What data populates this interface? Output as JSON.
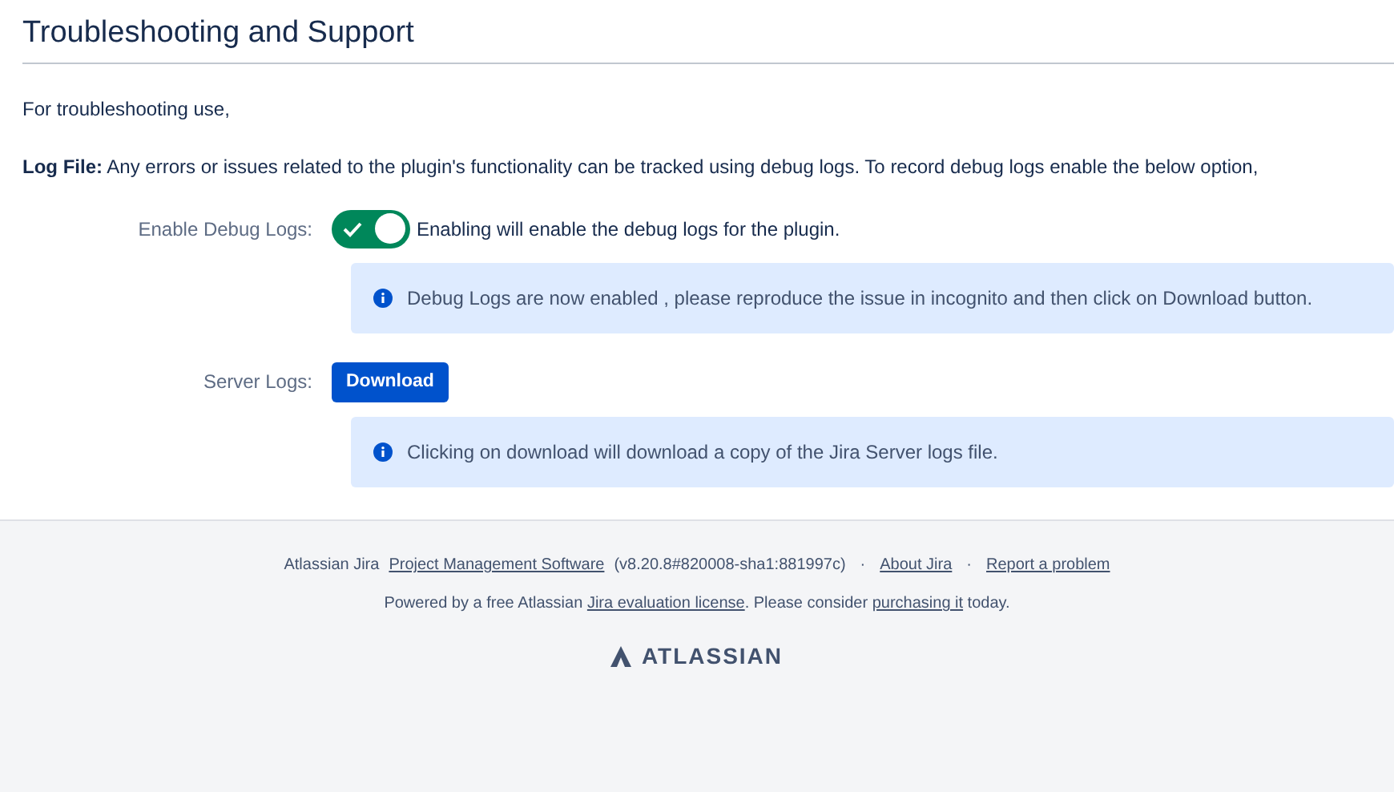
{
  "page": {
    "title": "Troubleshooting and Support"
  },
  "intro": "For troubleshooting use,",
  "log_file": "**Log File:** Any errors or issues related to the plugin's functionality can be tracked using debug logs. To record debug logs enable the below option,",
  "settings": [
    {
      "kind": "toggle",
      "label": "Enable Debug Logs:",
      "on": true,
      "description": "Enabling will enable the debug logs for the plugin.",
      "message": "Debug Logs are now enabled , please reproduce the issue in incognito and then click on Download button."
    },
    {
      "kind": "button",
      "label": "Server Logs:",
      "button": "Download",
      "message": "Clicking on download will download a copy of the Jira Server logs file."
    }
  ],
  "footer": {
    "version_line": [
      {
        "kind": "text",
        "text": "Atlassian Jira"
      },
      {
        "kind": "link",
        "text": "Project Management Software"
      },
      {
        "kind": "text",
        "text": "(v8.20.8#820008-sha1:881997c)"
      },
      {
        "kind": "separator",
        "text": "·"
      },
      {
        "kind": "link",
        "text": "About Jira"
      },
      {
        "kind": "separator",
        "text": "·"
      },
      {
        "kind": "link",
        "text": "Report a problem"
      }
    ],
    "license_line": [
      {
        "kind": "text",
        "text": "Powered by a free Atlassian "
      },
      {
        "kind": "link",
        "text": "Jira evaluation license"
      },
      {
        "kind": "text",
        "text": ". Please consider "
      },
      {
        "kind": "link",
        "text": "purchasing it"
      },
      {
        "kind": "text",
        "text": " today."
      }
    ],
    "logo": "ATLASSIAN"
  }
}
